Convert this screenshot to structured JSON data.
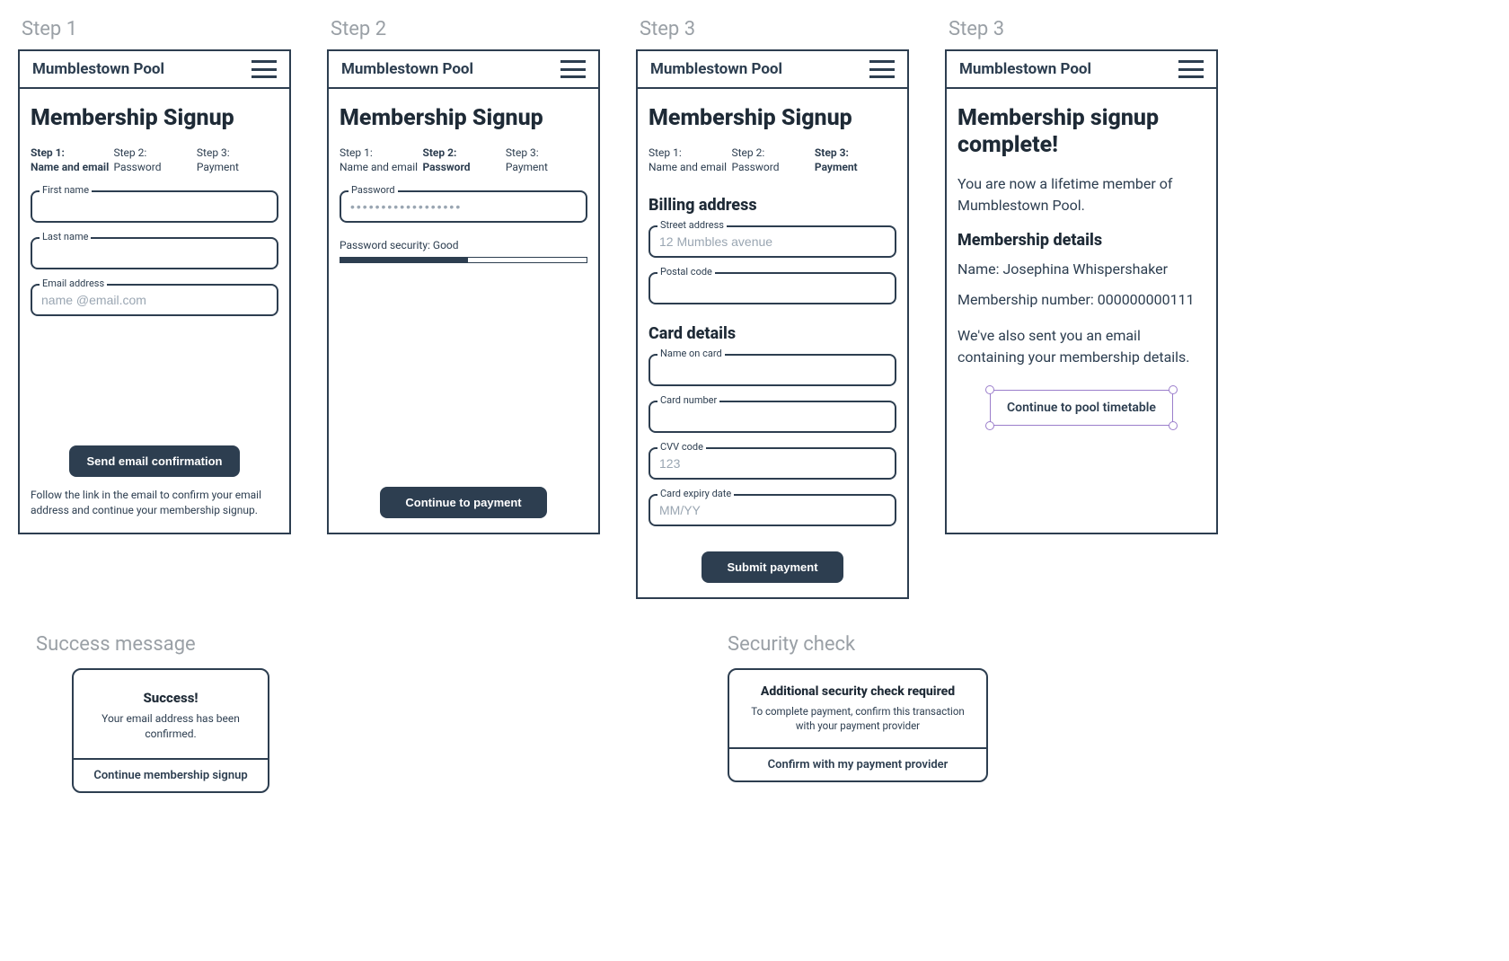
{
  "app_name": "Mumblestown Pool",
  "labels": {
    "screen1": "Step 1",
    "screen2": "Step 2",
    "screen3": "Step 3",
    "screen4": "Step 3",
    "success_section": "Success message",
    "security_section": "Security check"
  },
  "stepper": {
    "a_line1": "Step 1:",
    "a_line2": "Name and email",
    "b_line1": "Step 2:",
    "b_line2": "Password",
    "c_line1": "Step 3:",
    "c_line2": "Payment"
  },
  "screen1": {
    "title": "Membership Signup",
    "fields": {
      "first_name_label": "First name",
      "last_name_label": "Last name",
      "email_label": "Email address",
      "email_placeholder": "name @email.com"
    },
    "button": "Send email confirmation",
    "helper": "Follow the link in the email to confirm your email address and continue your membership signup."
  },
  "screen2": {
    "title": "Membership Signup",
    "password_label": "Password",
    "password_value": "••••••••••••••••••",
    "meter_label": "Password security: Good",
    "button": "Continue to payment"
  },
  "screen3": {
    "title": "Membership Signup",
    "billing_heading": "Billing address",
    "street_label": "Street address",
    "street_placeholder": "12 Mumbles avenue",
    "postal_label": "Postal code",
    "card_heading": "Card details",
    "name_on_card_label": "Name on card",
    "card_number_label": "Card number",
    "cvv_label": "CVV code",
    "cvv_placeholder": "123",
    "expiry_label": "Card expiry date",
    "expiry_placeholder": "MM/YY",
    "button": "Submit payment"
  },
  "screen4": {
    "title": "Membership signup complete!",
    "intro": "You are now a lifetime member of Mumblestown Pool.",
    "details_heading": "Membership details",
    "name_line": "Name: Josephina Whispershaker",
    "number_line": "Membership number: 000000000111",
    "email_line": "We've also sent you an email containing your membership details.",
    "button": "Continue to pool timetable"
  },
  "success_card": {
    "title": "Success!",
    "text": "Your email address has been confirmed.",
    "action": "Continue membership signup"
  },
  "security_card": {
    "title": "Additional security check required",
    "text": "To complete payment, confirm this transaction with your payment provider",
    "action": "Confirm with my payment provider"
  }
}
